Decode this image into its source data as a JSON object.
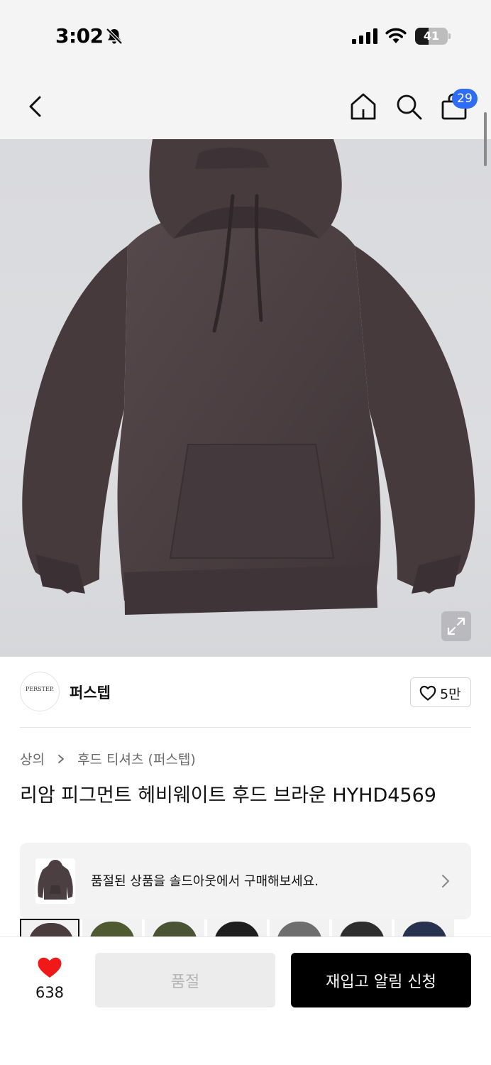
{
  "status_bar": {
    "time": "3:02",
    "battery": "41",
    "battery_level": 0.41
  },
  "nav": {
    "cart_count": "29"
  },
  "brand": {
    "logo_text": "PERSTEP.",
    "name": "퍼스텝",
    "likes": "5만"
  },
  "breadcrumb": {
    "category": "상의",
    "subcategory": "후드 티셔츠 (퍼스텝)"
  },
  "product": {
    "title": "리암 피그먼트 헤비웨이트 후드 브라운 HYHD4569"
  },
  "soldout_banner": {
    "text": "품절된 상품을 솔드아웃에서 구매해보세요."
  },
  "swatches": [
    {
      "color": "#4a3c3c"
    },
    {
      "color": "#4f5a32"
    },
    {
      "color": "#4a5333"
    },
    {
      "color": "#1e1e1e"
    },
    {
      "color": "#6e6e6e"
    },
    {
      "color": "#2e2e2e"
    },
    {
      "color": "#26324f"
    }
  ],
  "bottom_bar": {
    "wish_count": "638",
    "soldout_label": "품절",
    "restock_label": "재입고 알림 신청"
  },
  "colors": {
    "accent": "#2f6cf5",
    "heart": "#f01818",
    "hoodie": "#4b3f42"
  }
}
